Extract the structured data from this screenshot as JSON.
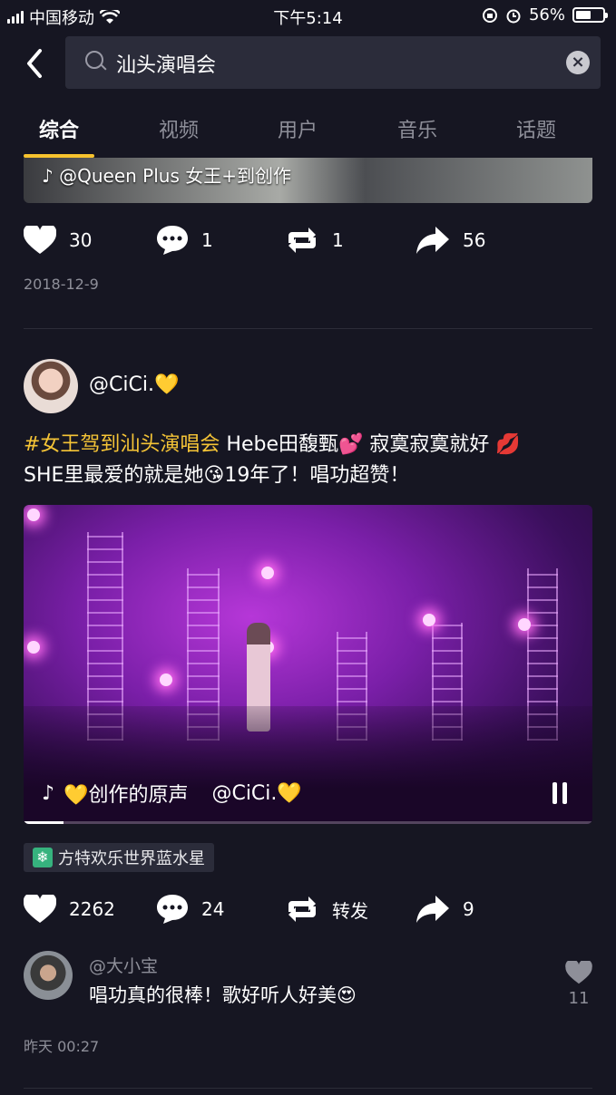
{
  "status_bar": {
    "carrier": "中国移动",
    "time": "下午5:14",
    "battery": "56%",
    "battery_level": 0.56
  },
  "header": {
    "search_value": "汕头演唱会"
  },
  "tabs": [
    {
      "label": "综合",
      "active": true
    },
    {
      "label": "视频"
    },
    {
      "label": "用户"
    },
    {
      "label": "音乐"
    },
    {
      "label": "话题"
    }
  ],
  "prev_post": {
    "video_caption": "@Queen Plus 女王+到创作",
    "likes": "30",
    "comments": "1",
    "reposts": "1",
    "shares": "56",
    "date": "2018-12-9"
  },
  "post": {
    "username": "@CiCi.💛",
    "hashtag": "#女王驾到汕头演唱会",
    "text_line1": " Hebe田馥甄💕 寂寞寂寞就好 💋",
    "text_line2": "SHE里最爱的就是她😘19年了！唱功超赞！",
    "video_sound": "💛创作的原声",
    "video_author": "@CiCi.💛",
    "video_progress": 0.07,
    "location": "方特欢乐世界蓝水星",
    "likes": "2262",
    "comments": "24",
    "repost_label": "转发",
    "shares": "9",
    "comment": {
      "user": "@大小宝",
      "text": "唱功真的很棒！歌好听人好美😍",
      "likes": "11"
    },
    "time": "昨天 00:27"
  },
  "colors": {
    "background": "#161622",
    "accent": "#f7c32e",
    "hashtag": "#f5c436",
    "muted": "#8e8f99"
  }
}
